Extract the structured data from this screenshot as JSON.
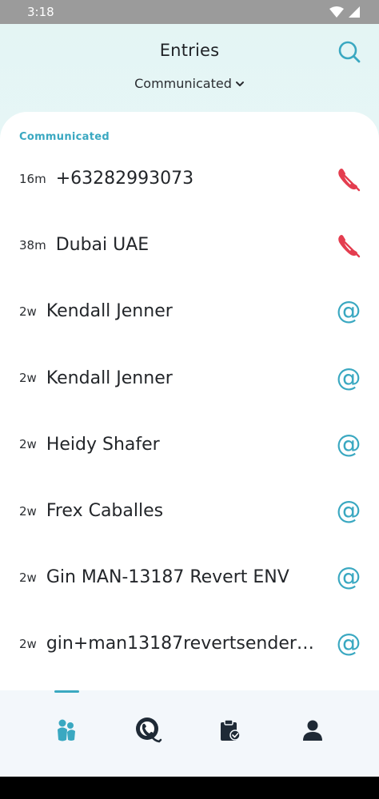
{
  "status_bar": {
    "time": "3:18"
  },
  "header": {
    "title": "Entries",
    "filter_value": "Communicated"
  },
  "section": {
    "label": "Communicated"
  },
  "entries": [
    {
      "time": "16m",
      "name": "+63282993073",
      "type": "missed-call-icon"
    },
    {
      "time": "38m",
      "name": "Dubai UAE",
      "type": "missed-call-icon"
    },
    {
      "time": "2w",
      "name": "Kendall Jenner",
      "type": "email-at-icon"
    },
    {
      "time": "2w",
      "name": "Kendall Jenner",
      "type": "email-at-icon"
    },
    {
      "time": "2w",
      "name": "Heidy Shafer",
      "type": "email-at-icon"
    },
    {
      "time": "2w",
      "name": "Frex Caballes",
      "type": "email-at-icon"
    },
    {
      "time": "2w",
      "name": "Gin MAN-13187 Revert ENV",
      "type": "email-at-icon"
    },
    {
      "time": "2w",
      "name": "gin+man13187revertsender…",
      "type": "email-at-icon"
    }
  ],
  "colors": {
    "accent": "#3aa8c1",
    "missed_call": "#e43d4f",
    "text": "#23262a",
    "nav_icon": "#1f2a36"
  },
  "bottom_nav": {
    "active_index": 0,
    "items": [
      "contacts-icon",
      "phone-icon",
      "clipboard-icon",
      "profile-icon"
    ]
  }
}
